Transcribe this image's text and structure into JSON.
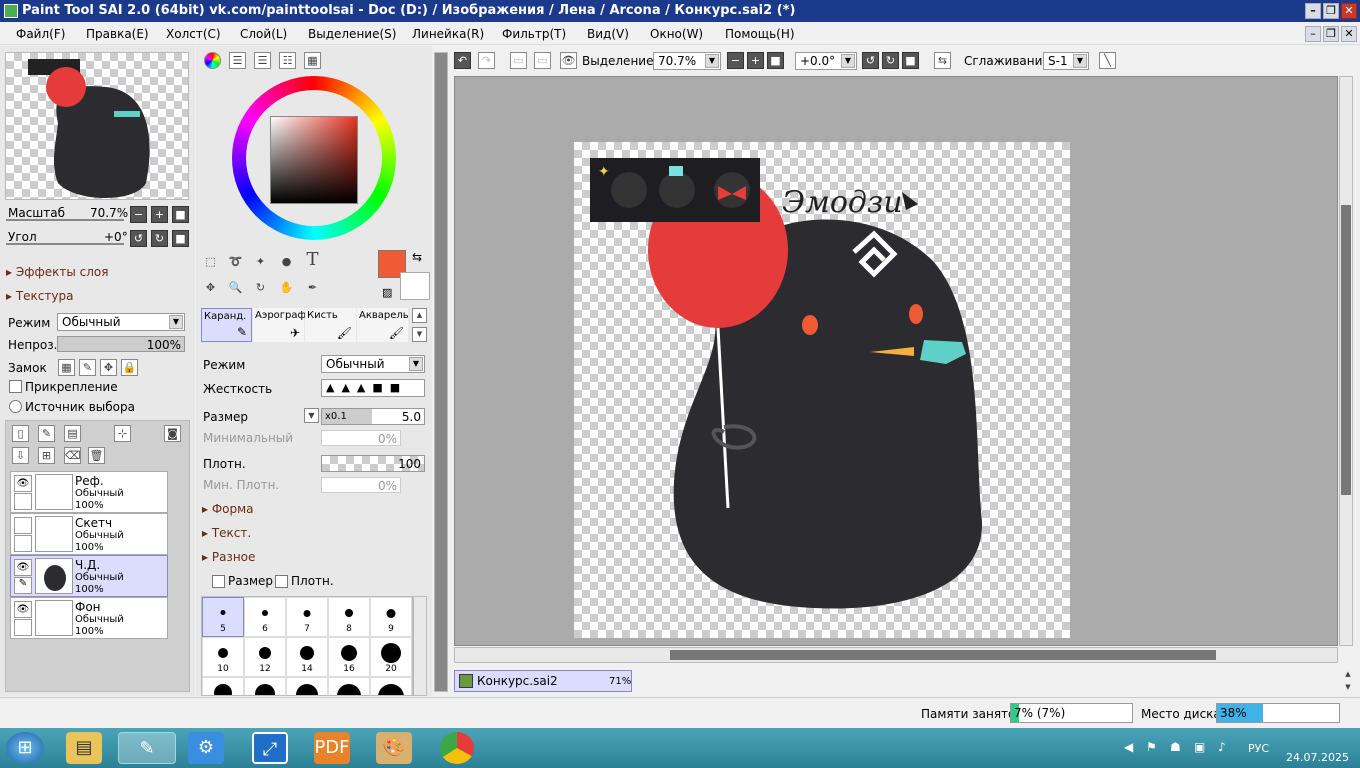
{
  "window": {
    "title": "Paint Tool SAI 2.0 (64bit) vk.com/painttoolsai - Doc (D:) / Изображения / Лена / Arcona / Конкурс.sai2 (*)",
    "minimize": "–",
    "restore": "❐",
    "close": "✕"
  },
  "menu": [
    "Файл(F)",
    "Правка(E)",
    "Холст(C)",
    "Слой(L)",
    "Выделение(S)",
    "Линейка(R)",
    "Фильтр(T)",
    "Вид(V)",
    "Окно(W)",
    "Помощь(H)"
  ],
  "navigator": {
    "zoom_label": "Масштаб",
    "zoom_value": "70.7%",
    "angle_label": "Угол",
    "angle_value": "+0°"
  },
  "layer_panel": {
    "effects": "Эффекты слоя",
    "texture": "Текстура",
    "mode_label": "Режим",
    "mode_value": "Обычный",
    "opacity_label": "Непроз.",
    "opacity_value": "100%",
    "lock_label": "Замок",
    "clip_label": "Прикрепление",
    "source_label": "Источник выбора",
    "layers": [
      {
        "name": "Реф.",
        "mode": "Обычный",
        "opacity": "100%"
      },
      {
        "name": "Скетч",
        "mode": "Обычный",
        "opacity": "100%"
      },
      {
        "name": "Ч.Д.",
        "mode": "Обычный",
        "opacity": "100%"
      },
      {
        "name": "Фон",
        "mode": "Обычный",
        "opacity": "100%"
      }
    ]
  },
  "tools": {
    "text_tool": "T",
    "brush_tabs": [
      "Каранд.",
      "Аэрограф",
      "Кисть",
      "Акварель"
    ],
    "mode_label": "Режим",
    "mode_value": "Обычный",
    "hardness_label": "Жесткость",
    "size_label": "Размер",
    "size_mult": "x0.1",
    "size_value": "5.0",
    "min_label": "Минимальный",
    "min_value": "0%",
    "density_label": "Плотн.",
    "density_value": "100",
    "min_density_label": "Мин. Плотн.",
    "min_density_value": "0%",
    "shape": "Форма",
    "texture": "Текст.",
    "misc": "Разное",
    "chk_size": "Размер",
    "chk_density": "Плотн.",
    "brush_sizes": [
      "5",
      "6",
      "7",
      "8",
      "9",
      "10",
      "12",
      "14",
      "16",
      "20"
    ],
    "primary_color": "#f05a35"
  },
  "toolbar": {
    "selection_label": "Выделение",
    "zoom_value": "70.7%",
    "angle_value": "+0.0°",
    "smoothing_label": "Сглаживание",
    "smoothing_value": "S-1"
  },
  "canvas": {
    "signature": "Эмодзи",
    "doc_tab": "Конкурс.sai2",
    "doc_zoom": "71%"
  },
  "status": {
    "memory_label": "Памяти занято",
    "memory_value": "7% (7%)",
    "disk_label": "Место диска",
    "disk_value": "38%",
    "memory_fill": 0.07,
    "disk_fill": 0.38
  },
  "taskbar": {
    "lang": "РУС",
    "date": "24.07.2025"
  }
}
